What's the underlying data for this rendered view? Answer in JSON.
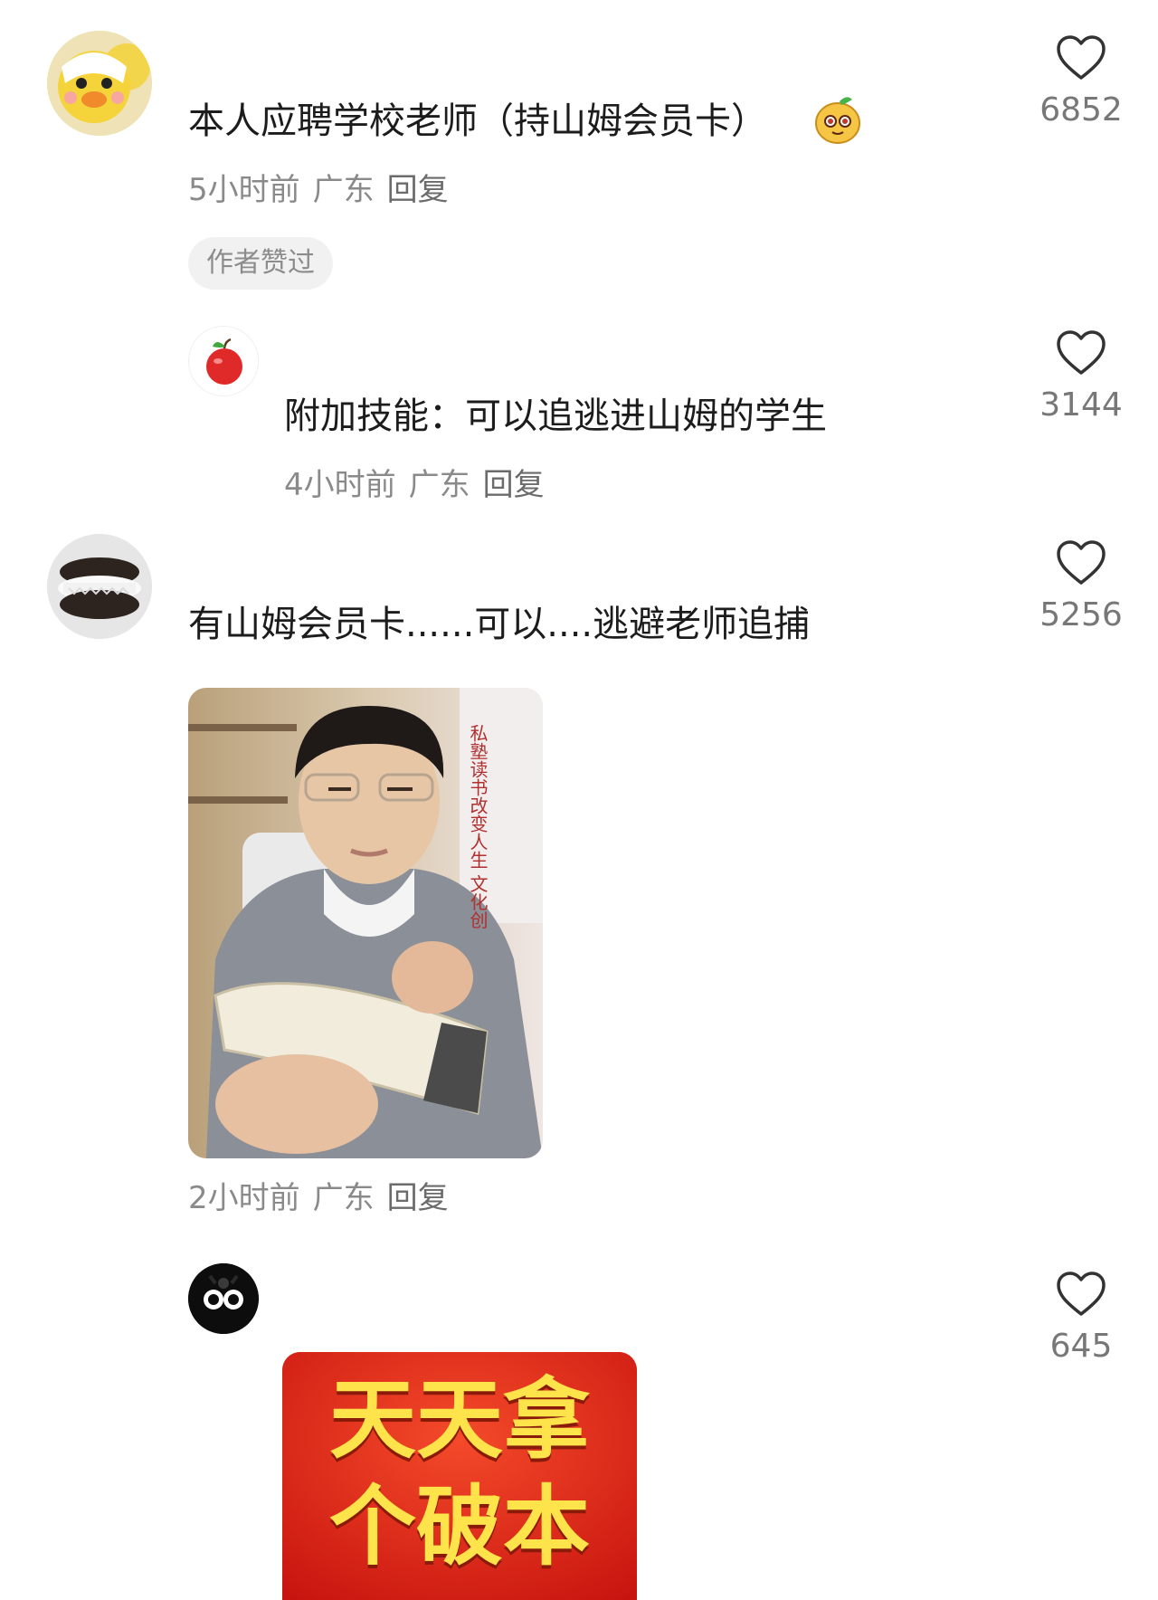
{
  "comments": [
    {
      "text": "本人应聘学校老师（持山姆会员卡）",
      "time": "5小时前",
      "location": "广东",
      "reply": "回复",
      "likes": "6852",
      "badge": "作者赞过",
      "avatar_icon": "yellow-duck-avatar",
      "emoji_icon": "mango-emoji-icon"
    },
    {
      "text": "附加技能：可以追逃进山姆的学生",
      "time": "4小时前",
      "location": "广东",
      "reply": "回复",
      "likes": "3144",
      "avatar_icon": "apple-avatar"
    },
    {
      "text": "有山姆会员卡......可以....逃避老师追捕",
      "time": "2小时前",
      "location": "广东",
      "reply": "回复",
      "likes": "5256",
      "avatar_icon": "oreo-avatar",
      "image_icon": "man-writing-notebook-photo",
      "image_wall_text": "私塾读书改变人生 文化创"
    },
    {
      "likes": "645",
      "avatar_icon": "black-cat-avatar",
      "sticker_text_line1": "天天拿",
      "sticker_text_line2": "个破本",
      "sticker_icon": "red-sticker-image"
    }
  ],
  "colors": {
    "meta_text": "#8a8a8a",
    "badge_bg": "#f1f1f1",
    "sticker_red": "#e0241c",
    "sticker_yellow": "#ffe34a"
  }
}
